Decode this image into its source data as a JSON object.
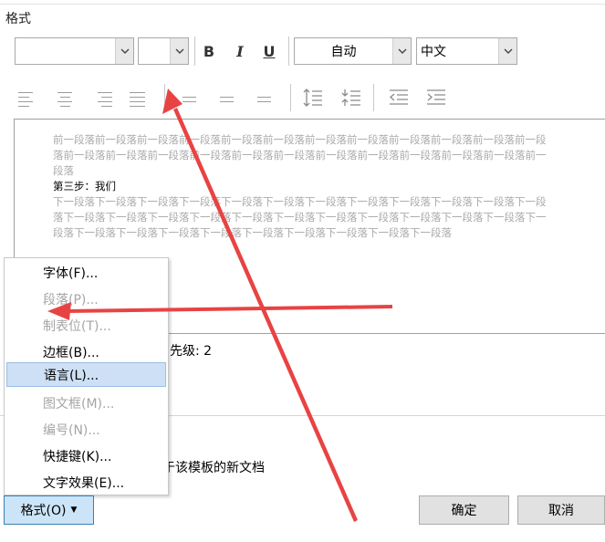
{
  "section": {
    "title": "格式"
  },
  "toolbar": {
    "font_name": "",
    "font_size": "",
    "bold_label": "B",
    "italic_label": "I",
    "underline_label": "U",
    "color_value": "自动",
    "language_value": "中文"
  },
  "preview": {
    "previous_paragraph": "前一段落前一段落前一段落前一段落前一段落前一段落前一段落前一段落前一段落前一段落前一段落前一段落前一段落前一段落前一段落前一段落前一段落前一段落前一段落前一段落前一段落前一段落前一段落前一段落",
    "current_paragraph": "第三步：我们",
    "next_paragraph": "下一段落下一段落下一段落下一段落下一段落下一段落下一段落下一段落下一段落下一段落下一段落下一段落下一段落下一段落下一段落下一段落下一段落下一段落下一段落下一段落下一段落下一段落下一段落下一段落下一段落下一段落下一段落下一段落下一段落下一段落下一段落下一段落下一段落"
  },
  "description": {
    "priority_fragment": "先级: 2",
    "template_fragment": "于该模板的新文档"
  },
  "format_menu": {
    "items": [
      {
        "label": "字体(F)...",
        "enabled": true,
        "hover": false
      },
      {
        "label": "段落(P)...",
        "enabled": false,
        "hover": false
      },
      {
        "label": "制表位(T)...",
        "enabled": false,
        "hover": false
      },
      {
        "label": "边框(B)...",
        "enabled": true,
        "hover": false
      },
      {
        "label": "语言(L)...",
        "enabled": true,
        "hover": true
      },
      {
        "label": "图文框(M)...",
        "enabled": false,
        "hover": false
      },
      {
        "label": "编号(N)...",
        "enabled": false,
        "hover": false
      },
      {
        "label": "快捷键(K)...",
        "enabled": true,
        "hover": false
      },
      {
        "label": "文字效果(E)...",
        "enabled": true,
        "hover": false
      }
    ]
  },
  "buttons": {
    "format_label": "格式(O)",
    "ok_label": "确定",
    "cancel_label": "取消"
  },
  "colors": {
    "annotation_arrow": "#e84343",
    "menu_hover": "#cde0f5",
    "format_button": "#cce4f7"
  }
}
